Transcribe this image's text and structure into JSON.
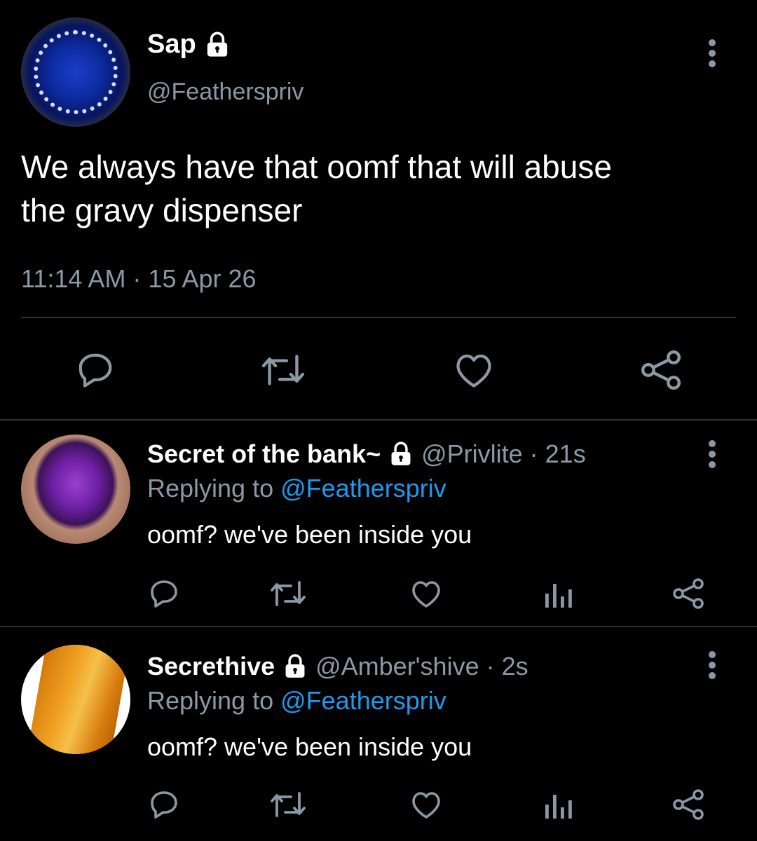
{
  "main_tweet": {
    "display_name": "Sap",
    "handle": "@Featherspriv",
    "text_line1": "We always have that oomf that will abuse",
    "text_line2": "the gravy dispenser",
    "timestamp": "11:14 AM · 15 Apr 26",
    "actions": [
      "reply-icon",
      "retweet-icon",
      "like-icon",
      "share-icon"
    ]
  },
  "replies": [
    {
      "display_name": "Secret of the bank~",
      "handle_time": "@Privlite · 21s",
      "replying_prefix": "Replying to ",
      "replying_to": "@Featherspriv",
      "text": "oomf? we've been inside you",
      "actions": [
        "reply-icon",
        "retweet-icon",
        "like-icon",
        "analytics-icon",
        "share-icon"
      ]
    },
    {
      "display_name": "Secrethive",
      "handle_time": "@Amber'shive · 2s",
      "replying_prefix": "Replying to ",
      "replying_to": "@Featherspriv",
      "text": "oomf? we've been inside you",
      "actions": [
        "reply-icon",
        "retweet-icon",
        "like-icon",
        "analytics-icon",
        "share-icon"
      ]
    }
  ],
  "colors": {
    "background": "#000000",
    "secondary_text": "#8b98a5",
    "link": "#1d9bf0",
    "divider": "#2f3336"
  }
}
